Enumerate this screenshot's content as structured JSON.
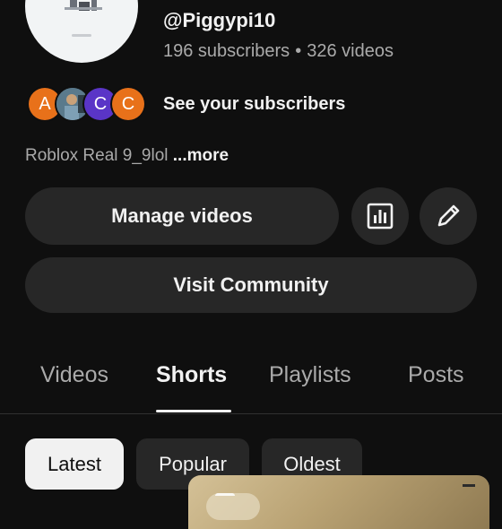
{
  "channel": {
    "handle": "@Piggypi10",
    "subscribers": "196 subscribers",
    "separator": "•",
    "videos": "326 videos",
    "see_subscribers": "See your subscribers",
    "description": "Roblox Real 9_9lol",
    "more_label": "...more"
  },
  "subscriber_avatars": [
    {
      "initial": "A",
      "color": "#e8711a"
    },
    {
      "initial": "",
      "color": "#5a7a8c"
    },
    {
      "initial": "C",
      "color": "#5a35c7"
    },
    {
      "initial": "C",
      "color": "#e8711a"
    }
  ],
  "actions": {
    "manage_videos": "Manage videos",
    "analytics_icon": "analytics-icon",
    "edit_icon": "pencil-icon",
    "visit_community": "Visit Community"
  },
  "tabs": [
    {
      "label": "Videos",
      "active": false
    },
    {
      "label": "Shorts",
      "active": true
    },
    {
      "label": "Playlists",
      "active": false
    },
    {
      "label": "Posts",
      "active": false
    }
  ],
  "sort_chips": [
    {
      "label": "Latest",
      "selected": true
    },
    {
      "label": "Popular",
      "selected": false
    },
    {
      "label": "Oldest",
      "selected": false
    }
  ],
  "colors": {
    "background": "#0f0f0f",
    "surface": "#272727",
    "text_primary": "#f1f1f1",
    "text_secondary": "#aaaaaa"
  }
}
